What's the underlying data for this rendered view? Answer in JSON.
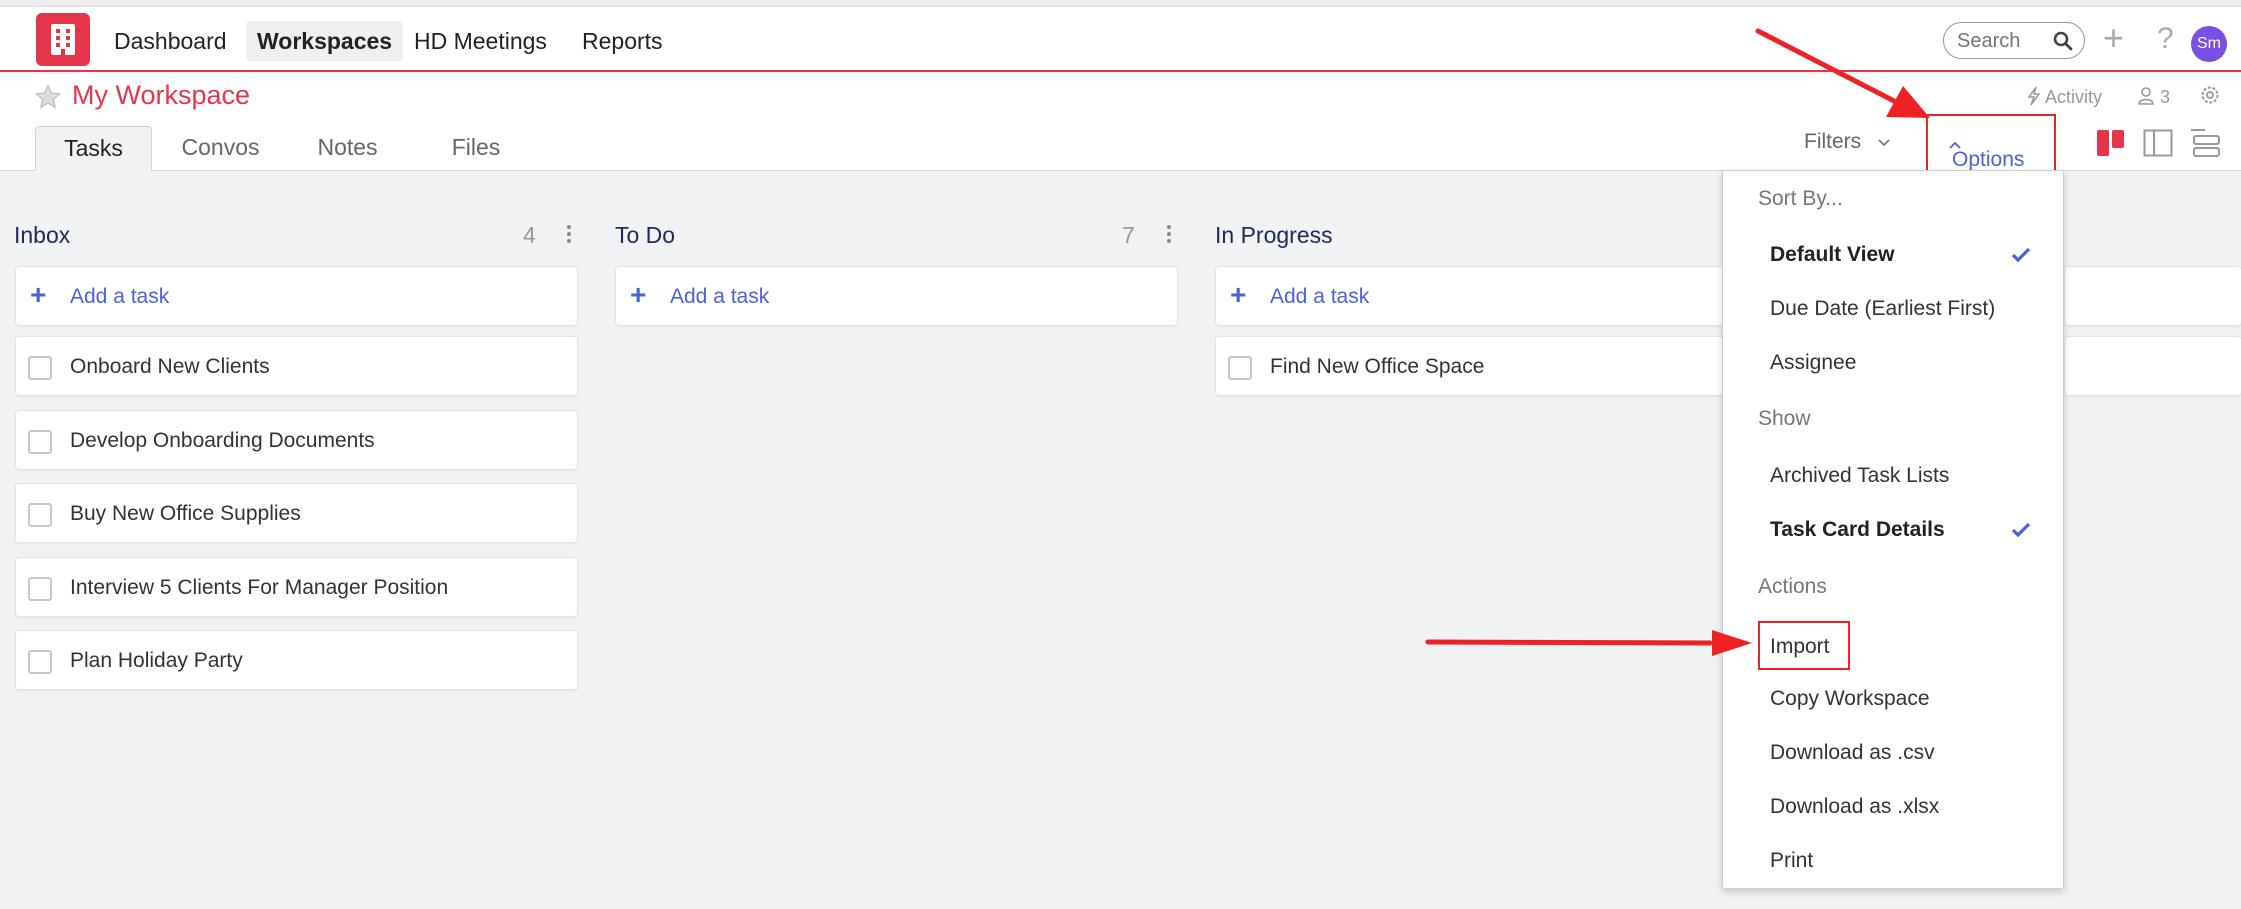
{
  "nav": {
    "items": [
      {
        "label": "Dashboard"
      },
      {
        "label": "Workspaces",
        "active": true
      },
      {
        "label": "HD Meetings"
      },
      {
        "label": "Reports"
      }
    ],
    "search_placeholder": "Search",
    "avatar_initials": "Sm"
  },
  "workspace": {
    "title": "My Workspace",
    "tabs": [
      "Tasks",
      "Convos",
      "Notes",
      "Files"
    ],
    "activity_label": "Activity",
    "member_count": "3",
    "filters_label": "Filters",
    "options_label": "Options"
  },
  "columns": [
    {
      "title": "Inbox",
      "count": "4",
      "add_label": "Add a task",
      "tasks": [
        "Onboard New Clients",
        "Develop Onboarding Documents",
        "Buy New Office Supplies",
        "Interview 5 Clients For Manager Position",
        "Plan Holiday Party"
      ]
    },
    {
      "title": "To Do",
      "count": "7",
      "add_label": "Add a task",
      "tasks": []
    },
    {
      "title": "In Progress",
      "count": "",
      "add_label": "Add a task",
      "tasks": [
        "Find New Office Space"
      ]
    }
  ],
  "options_menu": {
    "sort_header": "Sort By...",
    "sort_items": [
      "Default View",
      "Due Date (Earliest First)",
      "Assignee"
    ],
    "show_header": "Show",
    "show_items": [
      "Archived Task Lists",
      "Task Card Details"
    ],
    "actions_header": "Actions",
    "action_items": [
      "Import",
      "Copy Workspace",
      "Download as .csv",
      "Download as .xlsx",
      "Print"
    ]
  },
  "colors": {
    "brand": "#e5354a",
    "accent": "#4a63d8",
    "annotation": "#ee2222"
  }
}
